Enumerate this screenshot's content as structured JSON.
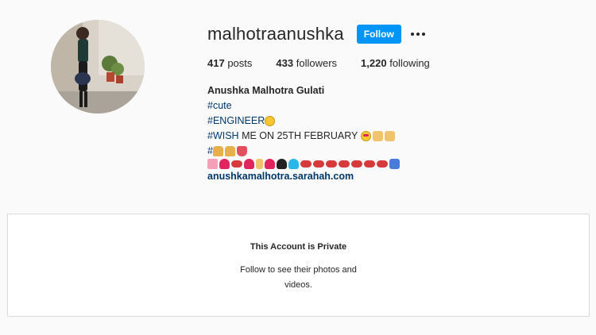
{
  "profile": {
    "username": "malhotraanushka",
    "follow_label": "Follow",
    "stats": {
      "posts_count": "417",
      "posts_label": "posts",
      "followers_count": "433",
      "followers_label": "followers",
      "following_count": "1,220",
      "following_label": "following"
    },
    "bio": {
      "full_name": "Anushka Malhotra Gulati",
      "tag_cute": "#cute",
      "tag_engineer": "#ENGINEER",
      "tag_wish": "#WISH",
      "wish_text": " ME ON 25TH FEBRUARY ",
      "hash_only": "#",
      "link": "anushkamalhotra.sarahah.com"
    }
  },
  "private_notice": {
    "title": "This Account is Private",
    "message": "Follow to see their photos and videos."
  },
  "colors": {
    "follow_button": "#0095f6",
    "hashtag": "#00376b",
    "background": "#fafafa"
  },
  "icons": {
    "more": "more-options-icon",
    "avatar": "profile-photo"
  }
}
